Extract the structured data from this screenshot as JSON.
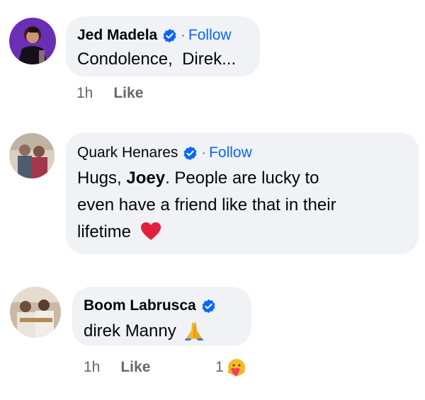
{
  "comments": [
    {
      "author": "Jed Madela",
      "follow": "Follow",
      "separator": "·",
      "text": "Condolence,  Direk...",
      "time": "1h",
      "like": "Like"
    },
    {
      "author": "Quark Henares",
      "follow": "Follow",
      "separator": "·",
      "text_line1_pre": "Hugs, ",
      "text_line1_bold": "Joey",
      "text_line1_post": ". People are lucky to",
      "text_line2": "even have a friend like that in their",
      "text_line3": "lifetime",
      "emoji": "red-heart-icon"
    },
    {
      "author": "Boom Labrusca",
      "text": "direk Manny",
      "emoji": "folded-hands-icon",
      "time": "1h",
      "like": "Like",
      "reaction_count": "1",
      "reaction_icon": "care-reaction-icon"
    }
  ],
  "colors": {
    "bubble": "#f0f2f5",
    "follow": "#0866ff",
    "meta": "#65676b",
    "verified": "#0866ff",
    "heart": "#e41e3f"
  }
}
